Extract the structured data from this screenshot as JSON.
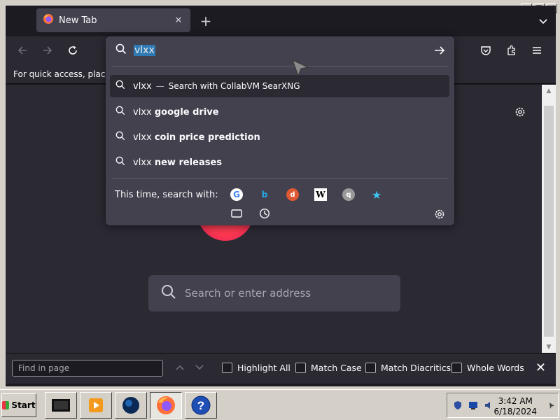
{
  "window": {
    "minimize": "_",
    "maximize": "□",
    "close": "✕"
  },
  "tab": {
    "title": "New Tab",
    "close": "✕"
  },
  "newtab_symbol": "+",
  "bookmarks_hint": "For quick access, place yo",
  "urlbar": {
    "typed_text": "vlxx"
  },
  "suggestions": [
    {
      "query": "vlxx",
      "separator": "—",
      "action": "Search with CollabVM SearXNG",
      "bold": ""
    },
    {
      "query": "vlxx",
      "separator": "",
      "action": "",
      "bold": "google drive"
    },
    {
      "query": "vlxx",
      "separator": "",
      "action": "",
      "bold": "coin price prediction"
    },
    {
      "query": "vlxx",
      "separator": "",
      "action": "",
      "bold": "new releases"
    }
  ],
  "one_off": {
    "label": "This time, search with:",
    "engines": [
      "G",
      "b",
      "d",
      "W",
      "q",
      "★"
    ]
  },
  "content": {
    "search_placeholder": "Search or enter address"
  },
  "findbar": {
    "placeholder": "Find in page",
    "highlight_all": "Highlight All",
    "match_case": "Match Case",
    "match_diacritics": "Match Diacritics",
    "whole_words": "Whole Words",
    "close": "✕"
  },
  "taskbar": {
    "start": "Start",
    "time": "3:42 AM",
    "date": "6/18/2024"
  },
  "colors": {
    "accent": "#2f7ab5",
    "toolbar": "#2b2a33",
    "panel": "#42414d",
    "firefox": "#ff3750"
  }
}
